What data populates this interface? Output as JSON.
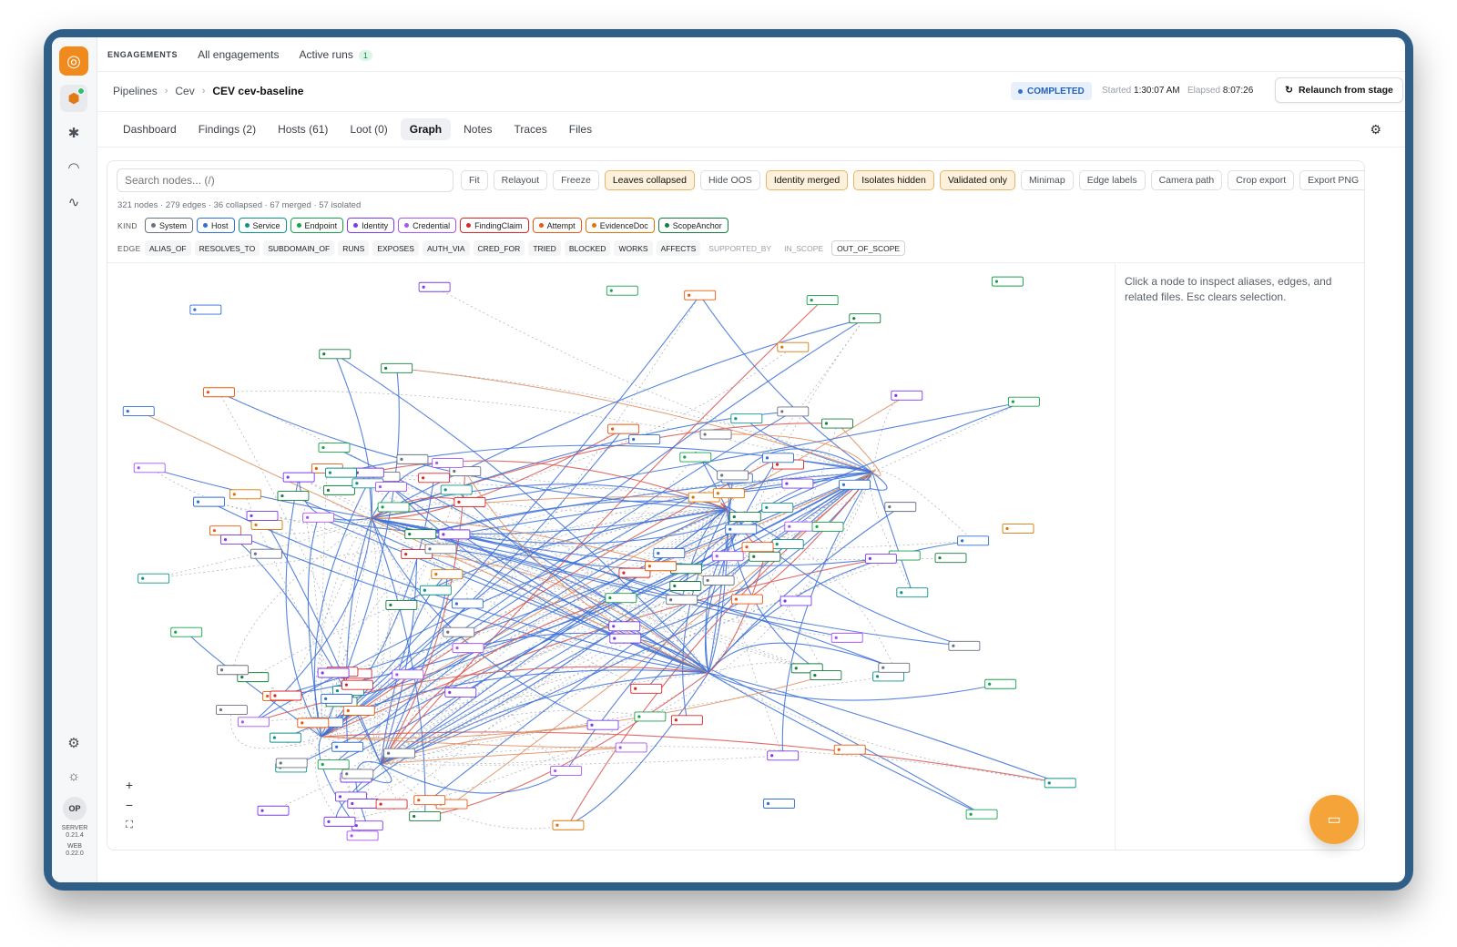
{
  "rail": {
    "logo_icon": "radar-logo-icon",
    "items": [
      "hosts-icon",
      "bug-icon",
      "gauge-icon",
      "activity-icon"
    ],
    "bottom": [
      "settings-icon",
      "theme-icon"
    ],
    "avatar": "OP",
    "server_label": "SERVER",
    "server_version": "0.21.4",
    "web_label": "WEB",
    "web_version": "0.22.0"
  },
  "topnav": {
    "section": "ENGAGEMENTS",
    "all": "All engagements",
    "active": "Active runs",
    "active_count": "1"
  },
  "breadcrumb": {
    "p1": "Pipelines",
    "p2": "Cev",
    "current": "CEV cev-baseline"
  },
  "run": {
    "status": "COMPLETED",
    "started_label": "Started",
    "started": "1:30:07 AM",
    "elapsed_label": "Elapsed",
    "elapsed": "8:07:26",
    "relaunch": "Relaunch from stage"
  },
  "tabs": [
    "Dashboard",
    "Findings (2)",
    "Hosts (61)",
    "Loot (0)",
    "Graph",
    "Notes",
    "Traces",
    "Files"
  ],
  "active_tab": "Graph",
  "graph": {
    "search_placeholder": "Search nodes... (/)",
    "tools": [
      {
        "label": "Fit",
        "on": false
      },
      {
        "label": "Relayout",
        "on": false
      },
      {
        "label": "Freeze",
        "on": false
      },
      {
        "label": "Leaves collapsed",
        "on": true
      },
      {
        "label": "Hide OOS",
        "on": false
      },
      {
        "label": "Identity merged",
        "on": true
      },
      {
        "label": "Isolates hidden",
        "on": true
      },
      {
        "label": "Validated only",
        "on": true
      },
      {
        "label": "Minimap",
        "on": false
      },
      {
        "label": "Edge labels",
        "on": false
      },
      {
        "label": "Camera path",
        "on": false
      },
      {
        "label": "Crop export",
        "on": false
      },
      {
        "label": "Export PNG",
        "on": false
      }
    ],
    "stats": "321 nodes · 279 edges · 36 collapsed · 67 merged · 57 isolated",
    "kind_label": "KIND",
    "kinds": [
      {
        "label": "System",
        "color": "#6b7280"
      },
      {
        "label": "Host",
        "color": "#2f6fd6"
      },
      {
        "label": "Service",
        "color": "#0d9488"
      },
      {
        "label": "Endpoint",
        "color": "#16a34a"
      },
      {
        "label": "Identity",
        "color": "#7c3aed"
      },
      {
        "label": "Credential",
        "color": "#a855f7"
      },
      {
        "label": "FindingClaim",
        "color": "#dc2626"
      },
      {
        "label": "Attempt",
        "color": "#ea580c"
      },
      {
        "label": "EvidenceDoc",
        "color": "#d97706"
      },
      {
        "label": "ScopeAnchor",
        "color": "#15803d"
      }
    ],
    "edge_label": "EDGE",
    "edges": [
      {
        "label": "ALIAS_OF",
        "state": "on"
      },
      {
        "label": "RESOLVES_TO",
        "state": "on"
      },
      {
        "label": "SUBDOMAIN_OF",
        "state": "on"
      },
      {
        "label": "RUNS",
        "state": "on"
      },
      {
        "label": "EXPOSES",
        "state": "on"
      },
      {
        "label": "AUTH_VIA",
        "state": "on"
      },
      {
        "label": "CRED_FOR",
        "state": "on"
      },
      {
        "label": "TRIED",
        "state": "on"
      },
      {
        "label": "BLOCKED",
        "state": "on"
      },
      {
        "label": "WORKS",
        "state": "on"
      },
      {
        "label": "AFFECTS",
        "state": "on"
      },
      {
        "label": "SUPPORTED_BY",
        "state": "off"
      },
      {
        "label": "IN_SCOPE",
        "state": "off"
      },
      {
        "label": "OUT_OF_SCOPE",
        "state": "sel"
      }
    ],
    "inspector_hint": "Click a node to inspect aliases, edges, and related files. Esc clears selection.",
    "zoom_in": "+",
    "zoom_out": "−",
    "fullscreen_icon": "fullscreen-icon"
  },
  "fab_icon": "chat-icon"
}
